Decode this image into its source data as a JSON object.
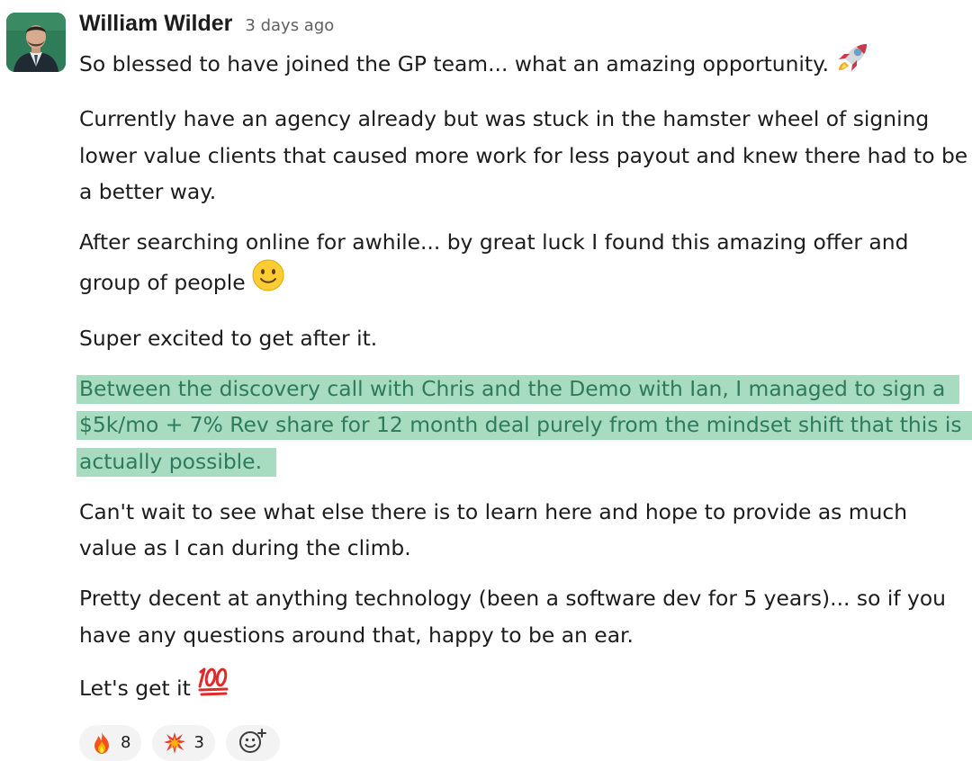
{
  "message": {
    "author": "William Wilder",
    "timestamp": "3 days ago",
    "avatar_icon": "user-photo",
    "paragraphs": [
      "So blessed to have joined the GP team... what an amazing opportunity.",
      "Currently have an agency already but was stuck in the hamster wheel of signing lower value clients that caused more work for less payout and knew there had to be a better way.",
      "After searching online for awhile... by great luck I found this amazing offer and group of people",
      "Super excited to get after it.",
      "Between the discovery call with Chris and the Demo with Ian, I managed to sign a $5k/mo + 7% Rev share for 12 month deal purely from the mindset shift that this is actually possible.",
      "Can't wait to see what else there is to learn here and hope to provide as much value as I can during the climb.",
      "Pretty decent at anything technology (been a software dev for 5 years)... so if you have any questions around that, happy to be an ear.",
      "Let's get it"
    ],
    "inline_emojis": {
      "p1": "rocket-icon",
      "p3": "slightly-smiling-face-icon",
      "p8": "hundred-points-icon"
    }
  },
  "reactions": [
    {
      "emoji": "fire-icon",
      "count": "8"
    },
    {
      "emoji": "collision-icon",
      "count": "3"
    }
  ],
  "add_reaction_icon": "add-reaction-icon",
  "colors": {
    "highlight_bg": "#a7dcc0",
    "highlight_text": "#2f7a59",
    "avatar_bg": "#2f7d58",
    "timestamp": "#616061",
    "reaction_bg": "#f4f3f3"
  }
}
